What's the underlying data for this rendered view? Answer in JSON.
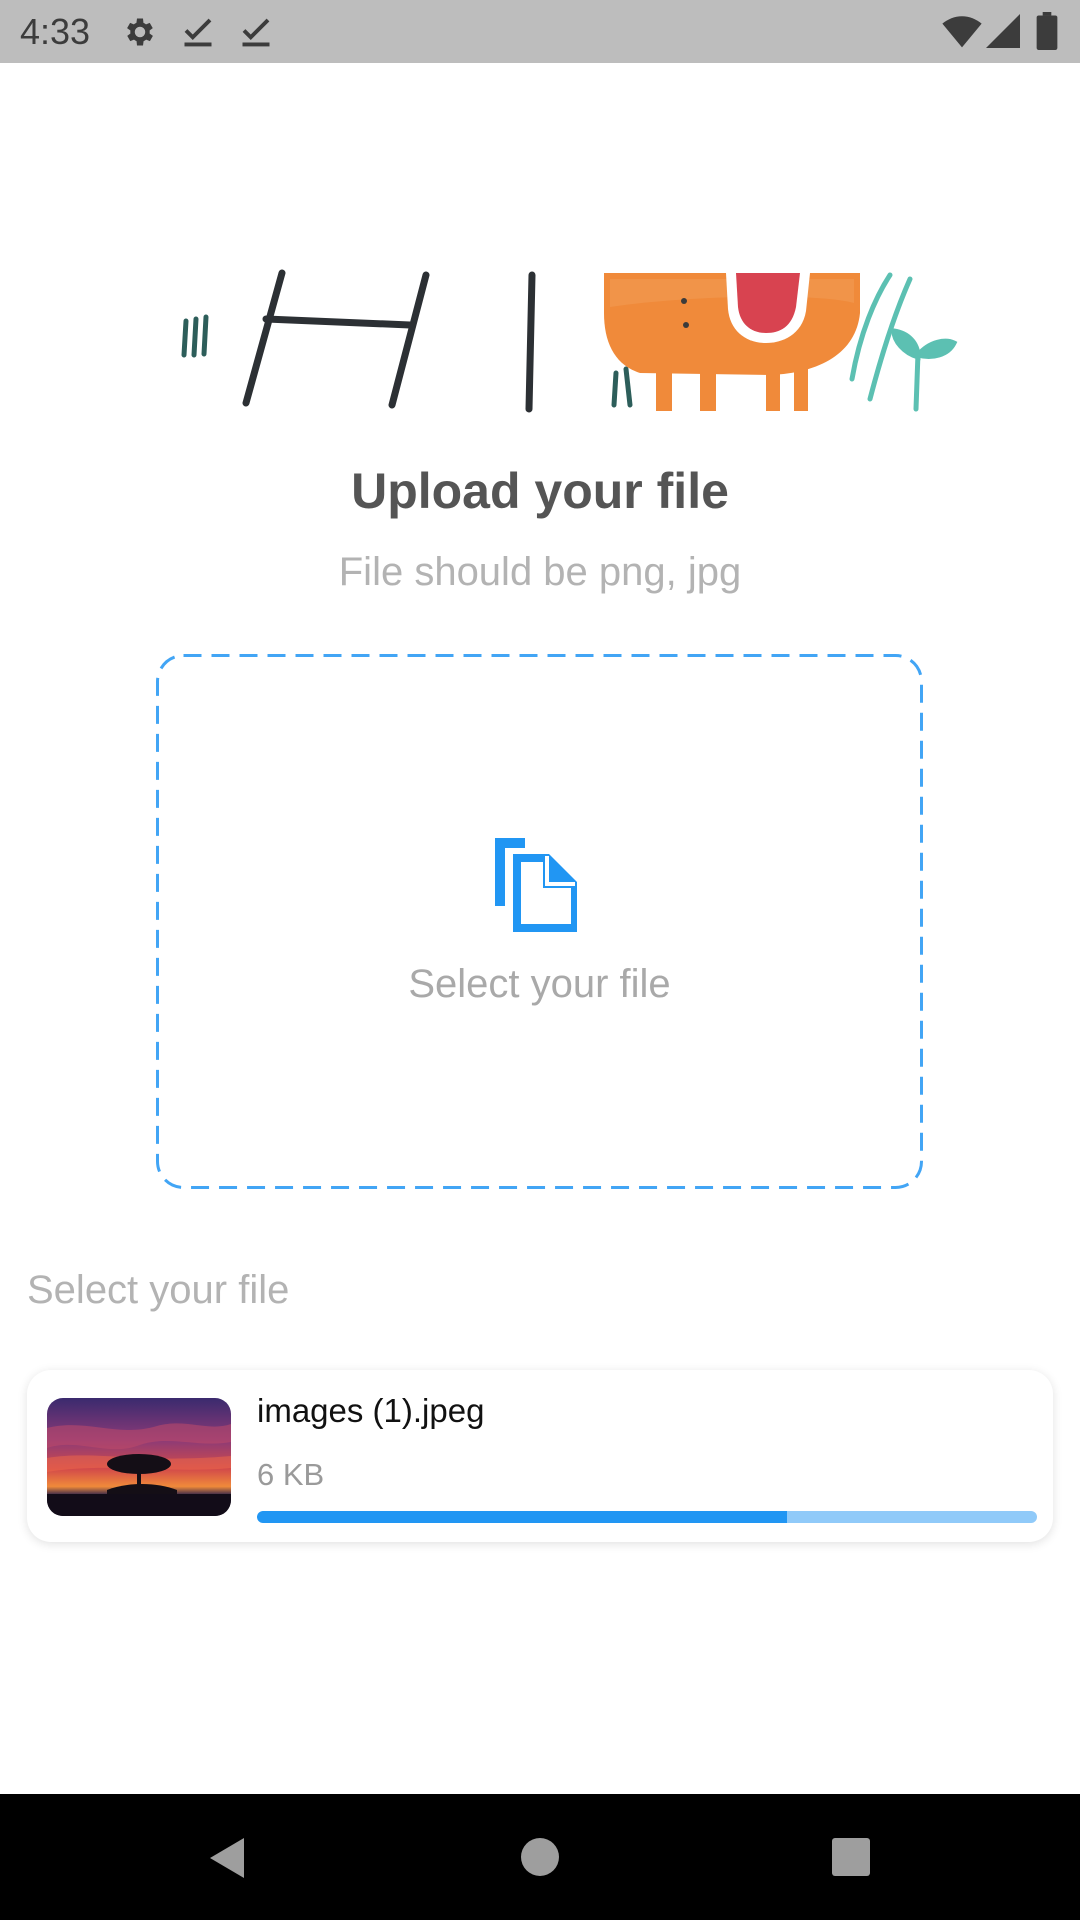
{
  "status_bar": {
    "time": "4:33",
    "icons": [
      "gear-icon",
      "download-done-icon",
      "download-done-icon",
      "wifi-icon",
      "signal-icon",
      "battery-icon"
    ]
  },
  "header": {
    "title": "Upload your file",
    "subtitle": "File should be png, jpg"
  },
  "dropzone": {
    "label": "Select your file",
    "icon": "file-copy-icon",
    "border_color": "#42a5f5"
  },
  "files_section": {
    "label": "Select your file",
    "files": [
      {
        "name": "images (1).jpeg",
        "size": "6 KB",
        "progress": 0.68
      }
    ]
  },
  "colors": {
    "accent": "#2196f3",
    "accent_light": "#90caf9",
    "title": "#555555",
    "muted": "#b3b3b3"
  },
  "nav_bar": {
    "icons": [
      "back-icon",
      "home-icon",
      "recents-icon"
    ]
  }
}
